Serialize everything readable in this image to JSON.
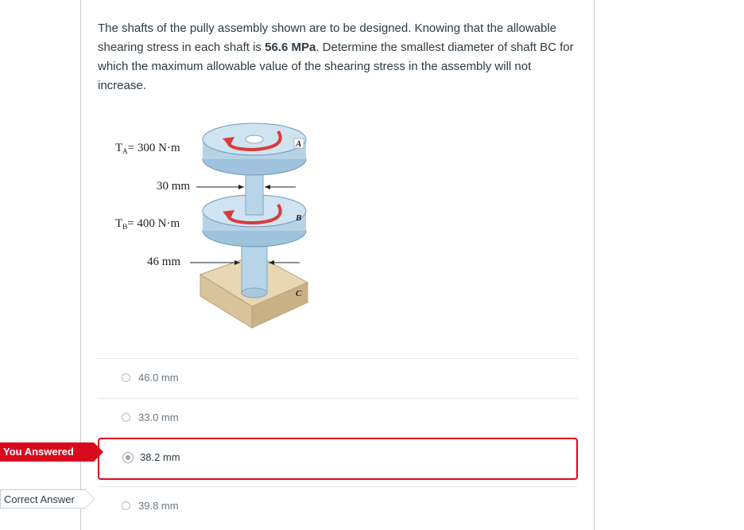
{
  "question": {
    "text_before": "The shafts of the pully assembly shown are to be designed. Knowing that the allowable shearing stress in each shaft is ",
    "stress_value": "56.6 MPa",
    "text_after": ". Determine the smallest diameter of shaft BC for which the maximum allowable value of the shearing stress in the assembly will not increase."
  },
  "figure": {
    "torque_a": "T",
    "torque_a_sub": "A",
    "torque_a_value": "= 300 N·m",
    "torque_b": "T",
    "torque_b_sub": "B",
    "torque_b_value": "= 400 N·m",
    "dim_top": "30 mm",
    "dim_bottom": "46 mm",
    "point_a": "A",
    "point_b": "B",
    "point_c": "C"
  },
  "answers": [
    {
      "label": "46.0 mm",
      "selected": false
    },
    {
      "label": "33.0 mm",
      "selected": false
    },
    {
      "label": "38.2 mm",
      "selected": true
    },
    {
      "label": "39.8 mm",
      "selected": false
    }
  ],
  "tags": {
    "you_answered": "You Answered",
    "correct_answer": "Correct Answer"
  },
  "colors": {
    "incorrect_red": "#d9091e",
    "pulley_blue": "#9fc3dc",
    "arrow_red": "#d93b3b",
    "base_tan": "#e8d7b3"
  }
}
